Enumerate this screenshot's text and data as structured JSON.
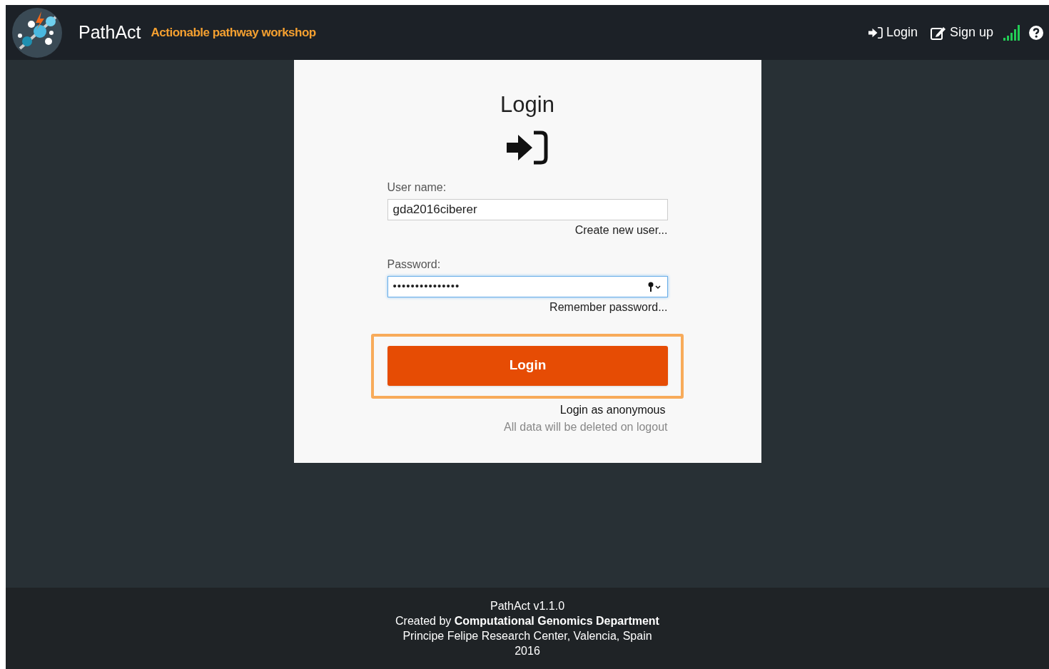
{
  "header": {
    "brand": "PathAct",
    "tagline": "Actionable pathway workshop",
    "links": [
      {
        "kind": "login",
        "label": "Login"
      },
      {
        "kind": "signup",
        "label": "Sign up"
      }
    ]
  },
  "form": {
    "title": "Login",
    "username": {
      "label": "User name:",
      "value": "gda2016ciberer",
      "link": "Create new user..."
    },
    "password": {
      "label": "Password:",
      "value": "•••••••••••••••",
      "focused": true,
      "link": "Remember password..."
    },
    "submit": {
      "label": "Login",
      "highlighted": true
    },
    "anonymous": {
      "link": "Login as anonymous",
      "note": "All data will be deleted on logout"
    }
  },
  "footer": {
    "lines": [
      "PathAct v1.1.0",
      "Created by **Computational Genomics Department**",
      "Principe Felipe Research Center, Valencia, Spain",
      "2016"
    ]
  }
}
